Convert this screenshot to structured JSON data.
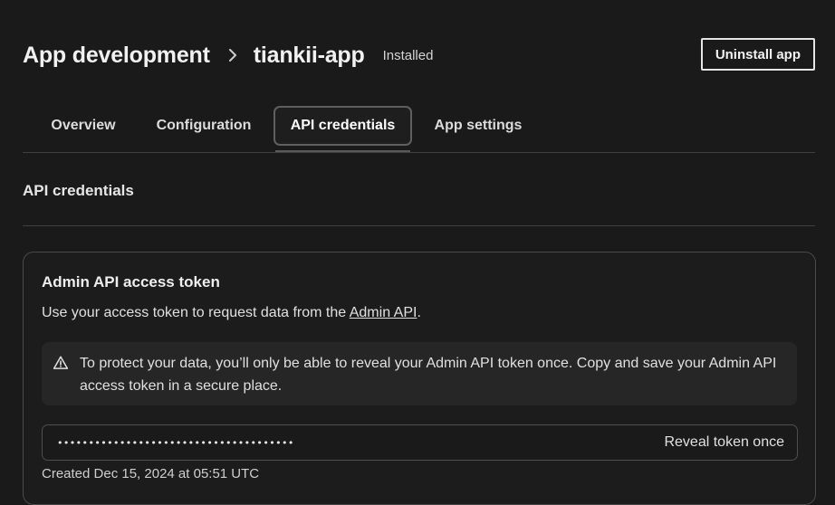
{
  "header": {
    "breadcrumb_root": "App development",
    "app_name": "tiankii-app",
    "status": "Installed",
    "uninstall_label": "Uninstall app"
  },
  "tabs": [
    {
      "label": "Overview",
      "active": false
    },
    {
      "label": "Configuration",
      "active": false
    },
    {
      "label": "API credentials",
      "active": true
    },
    {
      "label": "App settings",
      "active": false
    }
  ],
  "section": {
    "title": "API credentials"
  },
  "card": {
    "title": "Admin API access token",
    "desc_prefix": "Use your access token to request data from the ",
    "desc_link": "Admin API",
    "desc_suffix": ".",
    "banner_icon": "warning-triangle-icon",
    "banner_text": "To protect your data, you’ll only be able to reveal your Admin API token once. Copy and save your Admin API access token in a secure place.",
    "token_masked": "••••••••••••••••••••••••••••••••••••••",
    "reveal_label": "Reveal token once",
    "created": "Created Dec 15, 2024 at 05:51 UTC"
  }
}
